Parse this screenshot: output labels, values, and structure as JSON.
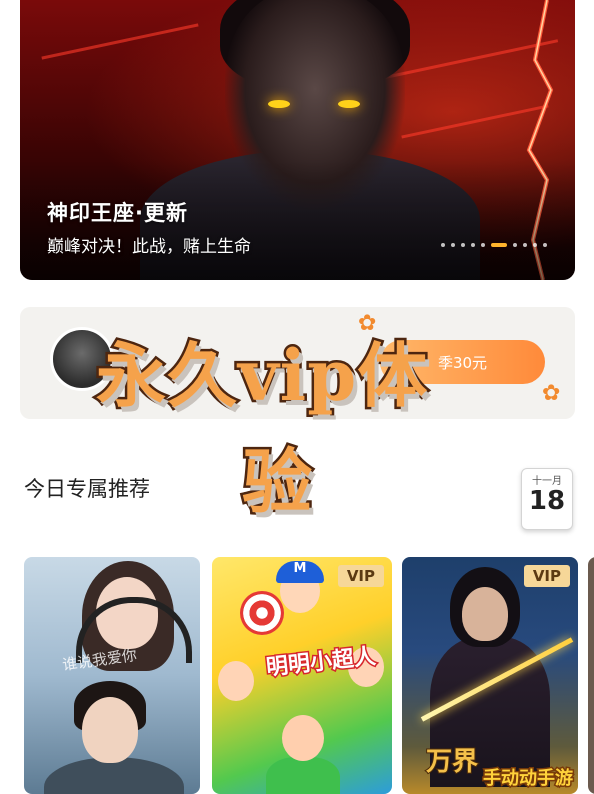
{
  "hero": {
    "title": "神印王座·更新",
    "subtitle": "巅峰对决！此战，赌上生命",
    "carousel_total": 10,
    "carousel_active_index": 5
  },
  "vip_banner": {
    "button_text": "季30元",
    "overlay_line1": "永久vip体",
    "overlay_line2": "验"
  },
  "recommendations": {
    "title": "今日专属推荐",
    "calendar_month": "十一月",
    "calendar_day": "18"
  },
  "cards": [
    {
      "title_art": "谁说我爱你",
      "badge": ""
    },
    {
      "title_art": "明明小超人",
      "badge": "VIP"
    },
    {
      "title_art": "万界",
      "badge": "VIP"
    }
  ],
  "watermark": "手动动手游",
  "colors": {
    "accent_orange": "#ff8a3a",
    "vip_gold": "#f6d798",
    "hero_red": "#7a0a0a"
  }
}
